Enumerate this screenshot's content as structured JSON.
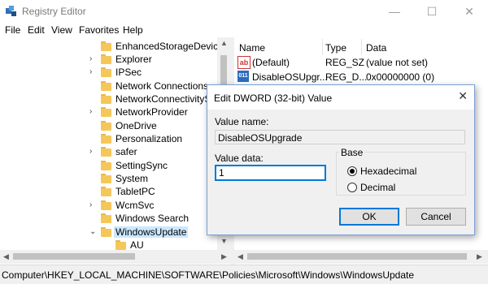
{
  "window": {
    "title": "Registry Editor",
    "minimize": "—",
    "maximize": "☐",
    "close": "✕"
  },
  "menu": [
    "File",
    "Edit",
    "View",
    "Favorites",
    "Help"
  ],
  "tree": {
    "items": [
      {
        "label": "EnhancedStorageDevices",
        "chevron": ""
      },
      {
        "label": "Explorer",
        "chevron": "›"
      },
      {
        "label": "IPSec",
        "chevron": "›"
      },
      {
        "label": "Network Connections",
        "chevron": ""
      },
      {
        "label": "NetworkConnectivitySt",
        "chevron": ""
      },
      {
        "label": "NetworkProvider",
        "chevron": "›"
      },
      {
        "label": "OneDrive",
        "chevron": ""
      },
      {
        "label": "Personalization",
        "chevron": ""
      },
      {
        "label": "safer",
        "chevron": "›"
      },
      {
        "label": "SettingSync",
        "chevron": ""
      },
      {
        "label": "System",
        "chevron": ""
      },
      {
        "label": "TabletPC",
        "chevron": ""
      },
      {
        "label": "WcmSvc",
        "chevron": "›"
      },
      {
        "label": "Windows Search",
        "chevron": ""
      },
      {
        "label": "WindowsUpdate",
        "chevron": "⌄",
        "selected": true
      },
      {
        "label": "AU",
        "chevron": "",
        "child": true
      }
    ]
  },
  "list": {
    "columns": [
      "Name",
      "Type",
      "Data"
    ],
    "rows": [
      {
        "icon": "ab",
        "name": "(Default)",
        "type": "REG_SZ",
        "data": "(value not set)"
      },
      {
        "icon": "011",
        "name": "DisableOSUpgr...",
        "type": "REG_D...",
        "data": "0x00000000 (0)"
      }
    ]
  },
  "status": "Computer\\HKEY_LOCAL_MACHINE\\SOFTWARE\\Policies\\Microsoft\\Windows\\WindowsUpdate",
  "dialog": {
    "title": "Edit DWORD (32-bit) Value",
    "close": "✕",
    "value_name_label": "Value name:",
    "value_name": "DisableOSUpgrade",
    "value_data_label": "Value data:",
    "value_data": "1",
    "base_label": "Base",
    "hex_label": "Hexadecimal",
    "dec_label": "Decimal",
    "base_selected": "Hexadecimal",
    "ok_label": "OK",
    "cancel_label": "Cancel"
  }
}
